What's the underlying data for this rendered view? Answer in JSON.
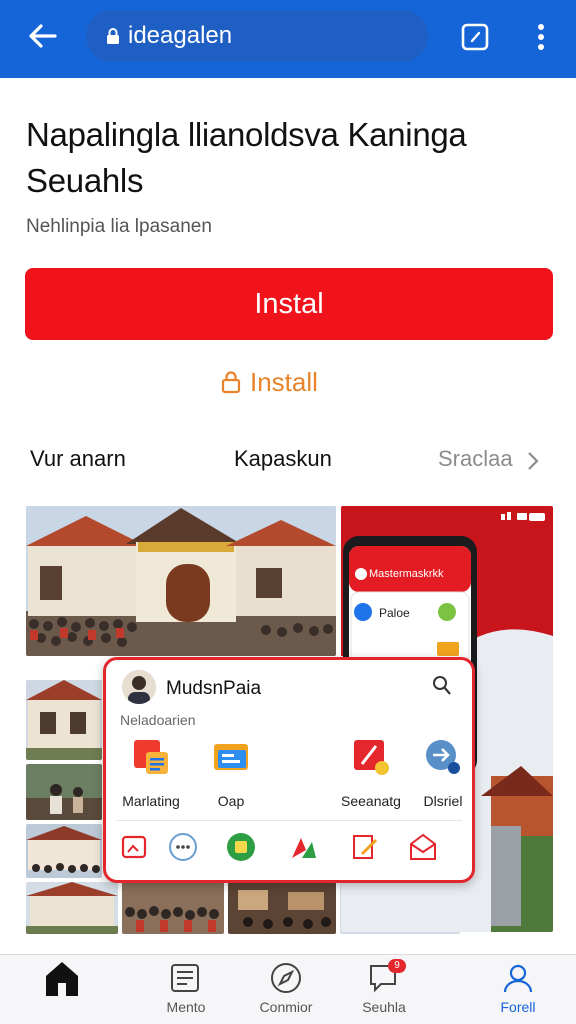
{
  "toolbar": {
    "address_text": "ideagalen",
    "back_icon": "arrow-left-icon",
    "tab_icon": "tab-switch-icon",
    "menu_icon": "more-vertical-icon"
  },
  "page": {
    "title": "Napalingla llianoldsva Kaninga Seuahls",
    "subtitle": "Nehlinpia lia lpasanen",
    "install_primary": "Instal",
    "install_secondary": "Install"
  },
  "tabs": [
    "Vur anarn",
    "Kapaskun",
    "Sraclaa"
  ],
  "card": {
    "name": "MudsnPaia",
    "subtitle": "Neladoarien",
    "apps": [
      {
        "label": "Marlating",
        "icon": "document-chart-icon"
      },
      {
        "label": "Oap",
        "icon": "folder-icon"
      },
      {
        "label": "Seeanatg",
        "icon": "pen-tool-icon"
      },
      {
        "label": "Dlsriel",
        "icon": "share-icon"
      }
    ]
  },
  "phone_preview": {
    "header_text": "Mastermaskrkk",
    "row_text": "Paloe"
  },
  "bottom_nav": [
    {
      "label": "",
      "icon": "home-icon",
      "active": false
    },
    {
      "label": "Mento",
      "icon": "news-icon",
      "active": false
    },
    {
      "label": "Conmior",
      "icon": "compass-icon",
      "active": false
    },
    {
      "label": "Seuhla",
      "icon": "chat-icon",
      "active": false,
      "badge": "9"
    },
    {
      "label": "Forell",
      "icon": "profile-icon",
      "active": true
    }
  ],
  "colors": {
    "toolbar_blue": "#1565d8",
    "install_red": "#f0131b",
    "secondary_orange": "#e8832a",
    "card_border": "#e2262c"
  }
}
